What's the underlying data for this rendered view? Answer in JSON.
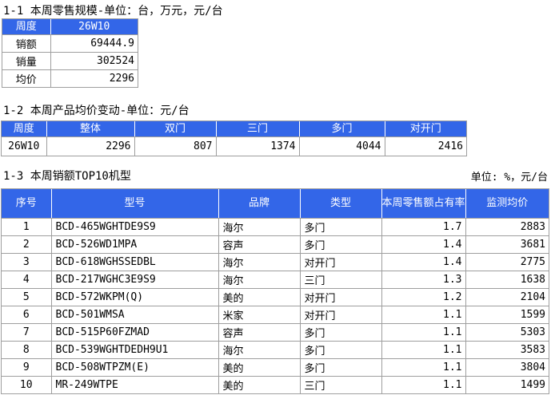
{
  "colors": {
    "header_blue": "#3366e8",
    "border_gray": "#9e9e9e",
    "header_text": "#ffffff",
    "body_text": "#000000"
  },
  "section1": {
    "title": "1-1 本周零售规模-单位：台，万元，元/台",
    "table": {
      "header_label": "周度",
      "header_value": "26W10",
      "rows": [
        {
          "label": "销额",
          "value": "69444.9"
        },
        {
          "label": "销量",
          "value": "302524"
        },
        {
          "label": "均价",
          "value": "2296"
        }
      ]
    }
  },
  "section2": {
    "title": "1-2 本周产品均价变动-单位：元/台",
    "table": {
      "headers": [
        "周度",
        "整体",
        "双门",
        "三门",
        "多门",
        "对开门"
      ],
      "row": [
        "26W10",
        "2296",
        "807",
        "1374",
        "4044",
        "2416"
      ]
    }
  },
  "section3": {
    "title": "1-3 本周销额TOP10机型",
    "unit_label": "单位: %，元/台",
    "table": {
      "headers": [
        "序号",
        "型号",
        "品牌",
        "类型",
        "本周零售额占有率",
        "监测均价"
      ],
      "rows": [
        [
          "1",
          "BCD-465WGHTDE9S9",
          "海尔",
          "多门",
          "1.7",
          "2883"
        ],
        [
          "2",
          "BCD-526WD1MPA",
          "容声",
          "多门",
          "1.4",
          "3681"
        ],
        [
          "3",
          "BCD-618WGHSSEDBL",
          "海尔",
          "对开门",
          "1.4",
          "2775"
        ],
        [
          "4",
          "BCD-217WGHC3E9S9",
          "海尔",
          "三门",
          "1.3",
          "1638"
        ],
        [
          "5",
          "BCD-572WKPM(Q)",
          "美的",
          "对开门",
          "1.2",
          "2104"
        ],
        [
          "6",
          "BCD-501WMSA",
          "米家",
          "对开门",
          "1.1",
          "1599"
        ],
        [
          "7",
          "BCD-515P60FZMAD",
          "容声",
          "多门",
          "1.1",
          "5303"
        ],
        [
          "8",
          "BCD-539WGHTDEDH9U1",
          "海尔",
          "多门",
          "1.1",
          "3583"
        ],
        [
          "9",
          "BCD-508WTPZM(E)",
          "美的",
          "多门",
          "1.1",
          "3804"
        ],
        [
          "10",
          "MR-249WTPE",
          "美的",
          "三门",
          "1.1",
          "1499"
        ]
      ]
    }
  }
}
